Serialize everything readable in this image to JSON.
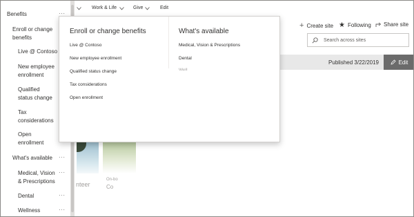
{
  "left_nav": {
    "items": [
      {
        "label": "Benefits",
        "more": "···"
      },
      {
        "label": "Enroll or change benefits",
        "more": "···"
      },
      {
        "label": "Live @ Contoso",
        "more": "···"
      },
      {
        "label": "New employee enrollment",
        "more": "···"
      },
      {
        "label": "Qualified status change",
        "more": "···"
      },
      {
        "label": "Tax considerations",
        "more": "···"
      },
      {
        "label": "Open enrollment",
        "more": "···"
      },
      {
        "label": "What's available",
        "more": "···"
      },
      {
        "label": "Medical, Vision & Prescriptions",
        "more": "···"
      },
      {
        "label": "Dental",
        "more": "···"
      },
      {
        "label": "Wellness programs",
        "more": "···"
      }
    ]
  },
  "top_nav": {
    "items": [
      "Work & Life",
      "Give",
      "Edit"
    ]
  },
  "header": {
    "create_site": "Create site",
    "following": "Following",
    "share_site": "Share site",
    "search_placeholder": "Search across sites"
  },
  "publish_bar": {
    "published": "Published 3/22/2019",
    "edit": "Edit"
  },
  "cards": {
    "card1_text": "nteer",
    "card2_text_1": "On-bo",
    "card2_text_2": "Co"
  },
  "mega_menu": {
    "col1": {
      "heading": "Enroll or change benefits",
      "links": [
        "Live @ Contoso",
        "New employee enrollment",
        "Qualified status change",
        "Tax considerations",
        "Open enrollment"
      ]
    },
    "col2": {
      "heading": "What's available",
      "links": [
        "Medical, Vision & Prescriptions",
        "Dental",
        "Well..."
      ]
    }
  }
}
